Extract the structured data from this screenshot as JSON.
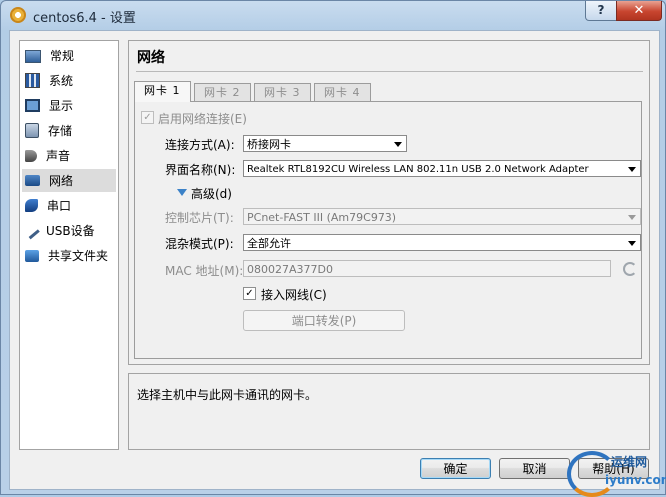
{
  "window": {
    "title": "centos6.4 - 设置",
    "help_btn": "?",
    "close_btn": "✕"
  },
  "sidebar": {
    "items": [
      {
        "label": "常规",
        "icon": "general-icon"
      },
      {
        "label": "系统",
        "icon": "system-icon"
      },
      {
        "label": "显示",
        "icon": "display-icon"
      },
      {
        "label": "存储",
        "icon": "storage-icon"
      },
      {
        "label": "声音",
        "icon": "audio-icon"
      },
      {
        "label": "网络",
        "icon": "network-icon",
        "selected": true
      },
      {
        "label": "串口",
        "icon": "serial-icon"
      },
      {
        "label": "USB设备",
        "icon": "usb-icon"
      },
      {
        "label": "共享文件夹",
        "icon": "shared-folder-icon"
      }
    ]
  },
  "panel": {
    "title": "网络",
    "tabs": [
      "网卡 1",
      "网卡 2",
      "网卡 3",
      "网卡 4"
    ],
    "enable_label": "启用网络连接(E)",
    "attach_label": "连接方式(A):",
    "attach_value": "桥接网卡",
    "name_label": "界面名称(N):",
    "name_value": "Realtek RTL8192CU Wireless LAN 802.11n USB 2.0 Network Adapter",
    "advanced_label": "高级(d)",
    "adapter_label": "控制芯片(T):",
    "adapter_value": "PCnet-FAST III (Am79C973)",
    "promisc_label": "混杂模式(P):",
    "promisc_value": "全部允许",
    "mac_label": "MAC 地址(M):",
    "mac_value": "080027A377D0",
    "cable_label": "接入网线(C)",
    "port_forward_btn": "端口转发(P)"
  },
  "description": "选择主机中与此网卡通讯的网卡。",
  "footer": {
    "ok": "确定",
    "cancel": "取消",
    "help": "帮助(H)"
  },
  "watermark": {
    "top": "运维网",
    "bottom": "iyunv.com"
  }
}
